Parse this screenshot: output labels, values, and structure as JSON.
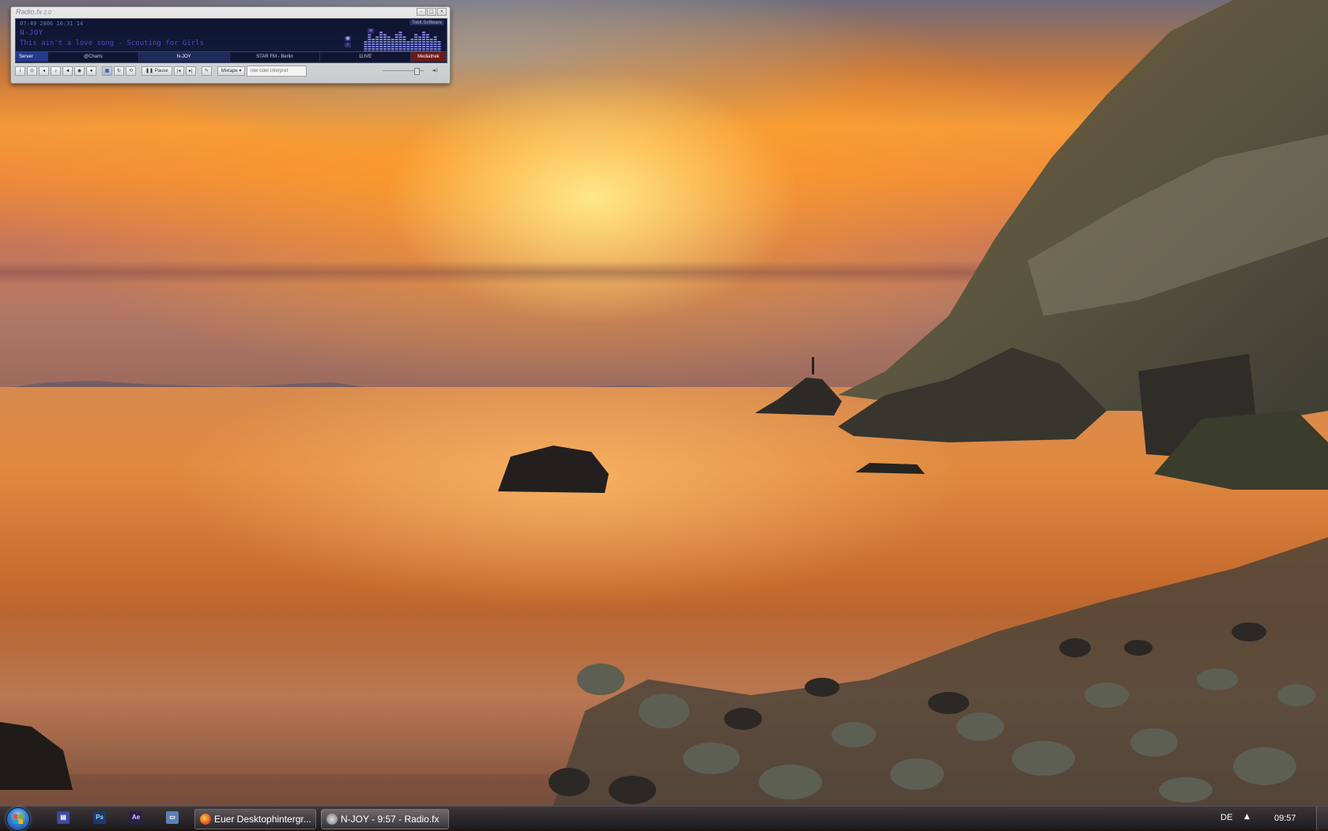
{
  "radio_window": {
    "app_title": "Radio.fx",
    "app_version": "2.0",
    "frequency_line": "07:49 2006 16:31 14",
    "station": "N-JOY",
    "track": "This ain't a love song - Scouting for Girls",
    "brand_badge": "Tobit.Software",
    "station_tabs": [
      {
        "label": "Server",
        "type": "server"
      },
      {
        "label": "@Charts",
        "type": "normal"
      },
      {
        "label": "N-JOY",
        "type": "active"
      },
      {
        "label": "STAR FM - Berlin",
        "type": "normal"
      },
      {
        "label": "1LIVE",
        "type": "normal"
      },
      {
        "label": "Mediathek",
        "type": "media"
      }
    ],
    "toolbar": {
      "pause_label": "Pause",
      "mixtape_label": "Mixtape",
      "search_placeholder": "Titel oder Interpret"
    },
    "spectrum_levels": [
      6,
      9,
      7,
      8,
      10,
      9,
      8,
      7,
      9,
      10,
      8,
      6,
      7,
      9,
      8,
      10,
      9,
      7,
      8,
      6
    ],
    "volume": 0.8
  },
  "taskbar": {
    "tasks": [
      {
        "label": "Euer Desktophintergr...",
        "icon": "firefox-icon"
      },
      {
        "label": "N-JOY - 9:57 - Radio.fx",
        "icon": "radiofx-icon"
      }
    ],
    "quicklaunch": [
      {
        "name": "window-switch-icon",
        "label": ""
      },
      {
        "name": "photoshop-icon",
        "label": "Ps"
      },
      {
        "name": "after-effects-icon",
        "label": "Ae"
      },
      {
        "name": "show-desktop-icon",
        "label": ""
      }
    ],
    "language": "DE",
    "clock": "09:57"
  },
  "colors": {
    "taskbar_text": "#ffffff",
    "display_bg": "#0e1530",
    "display_text": "#5448c0"
  }
}
